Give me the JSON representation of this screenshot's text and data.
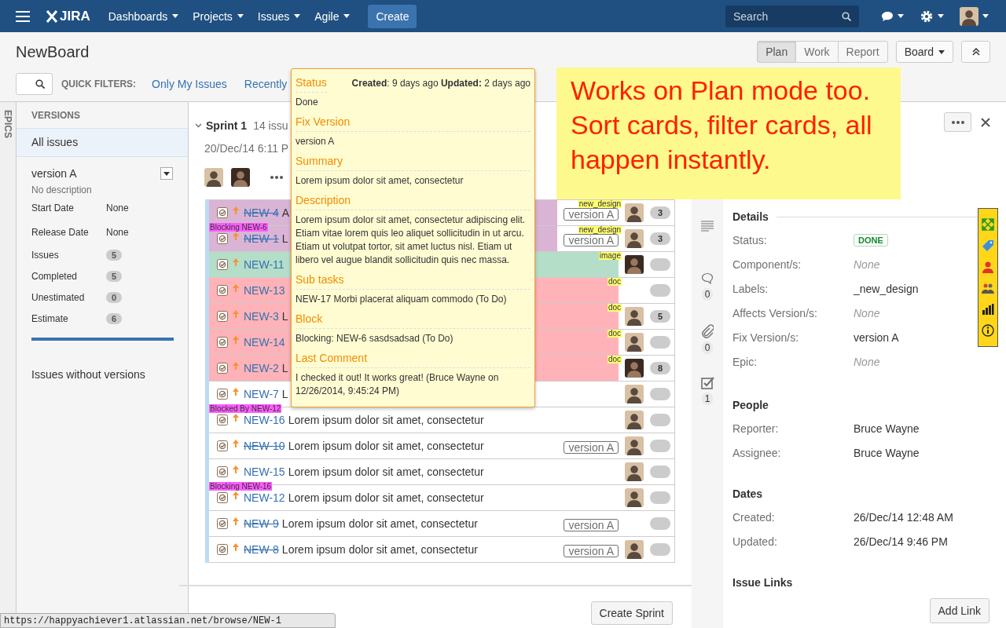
{
  "topbar": {
    "logo": "JIRA",
    "menu": [
      {
        "label": "Dashboards"
      },
      {
        "label": "Projects"
      },
      {
        "label": "Issues"
      },
      {
        "label": "Agile"
      }
    ],
    "create": "Create",
    "search": {
      "placeholder": "Search"
    }
  },
  "board": {
    "title": "NewBoard",
    "quick_filters_label": "QUICK FILTERS:",
    "quick_filters": [
      {
        "label": "Only My Issues"
      },
      {
        "label": "Recently"
      }
    ],
    "modes": [
      {
        "label": "Plan",
        "selected": true
      },
      {
        "label": "Work",
        "selected": false
      },
      {
        "label": "Report",
        "selected": false
      }
    ],
    "board_menu": "Board"
  },
  "epics_tab": "EPICS",
  "versions": {
    "heading": "VERSIONS",
    "items": [
      {
        "label": "All issues",
        "selected": true
      }
    ],
    "version": {
      "name": "version A",
      "description": "No description",
      "fields": [
        {
          "label": "Start Date",
          "value": "None"
        },
        {
          "label": "Release Date",
          "value": "None"
        }
      ],
      "stats": [
        {
          "label": "Issues",
          "count": "5"
        },
        {
          "label": "Completed",
          "count": "5"
        },
        {
          "label": "Unestimated",
          "count": "0"
        },
        {
          "label": "Estimate",
          "count": "6"
        }
      ],
      "progress": {
        "level": 1
      }
    },
    "without": "Issues without versions"
  },
  "sprint": {
    "name": "Sprint 1",
    "count": "14 issu",
    "date": "20/Dec/14 6:11 P",
    "participants": [
      {
        "kind": "light"
      },
      {
        "kind": "dark"
      }
    ],
    "rows": [
      {
        "key": "NEW-4",
        "done": true,
        "summary": "A",
        "color": "#dab4d5",
        "label": "new_design",
        "version": "version A",
        "assignee": {
          "kind": "light"
        },
        "estimate": "3"
      },
      {
        "key": "NEW-1",
        "done": true,
        "summary": "L",
        "color": "#dab4d5",
        "badge": "Blocking NEW-6",
        "label": "new_design",
        "version": "version A",
        "assignee": {
          "kind": "light"
        },
        "estimate": "3"
      },
      {
        "key": "NEW-11",
        "done": false,
        "color": "#b5dec9",
        "label": "image",
        "assignee": {
          "kind": "dark"
        }
      },
      {
        "key": "NEW-13",
        "done": false,
        "color": "#ffb3b8",
        "label": "doc"
      },
      {
        "key": "NEW-3",
        "done": false,
        "summary": "L",
        "color": "#ffb3b8",
        "label": "doc",
        "assignee": {
          "kind": "light"
        },
        "estimate": "5"
      },
      {
        "key": "NEW-14",
        "done": false,
        "color": "#ffb3b8",
        "label": "doc",
        "assignee": {
          "kind": "light"
        }
      },
      {
        "key": "NEW-2",
        "done": false,
        "summary": "L",
        "color": "#ffb3b8",
        "label": "doc",
        "assignee": {
          "kind": "dark"
        },
        "estimate": "8"
      },
      {
        "key": "NEW-7",
        "done": false,
        "summary": "L",
        "color": "#ffffff",
        "assignee": {
          "kind": "light"
        }
      },
      {
        "key": "NEW-16",
        "done": false,
        "summary": "Lorem ipsum dolor sit amet, consectetur",
        "color": "#ffffff",
        "badge": "Blocked By NEW-12",
        "assignee": {
          "kind": "light"
        }
      },
      {
        "key": "NEW-10",
        "done": true,
        "summary": "Lorem ipsum dolor sit amet, consectetur",
        "color": "#ffffff",
        "version": "version A",
        "assignee": {
          "kind": "light"
        }
      },
      {
        "key": "NEW-15",
        "done": false,
        "summary": "Lorem ipsum dolor sit amet, consectetur",
        "color": "#ffffff",
        "assignee": {
          "kind": "light"
        }
      },
      {
        "key": "NEW-12",
        "done": false,
        "summary": "Lorem ipsum dolor sit amet, consectetur",
        "color": "#ffffff",
        "badge": "Blocking NEW-16",
        "assignee": {
          "kind": "light"
        }
      },
      {
        "key": "NEW-9",
        "done": true,
        "summary": "Lorem ipsum dolor sit amet, consectetur",
        "color": "#ffffff",
        "version": "version A"
      },
      {
        "key": "NEW-8",
        "done": true,
        "summary": "Lorem ipsum dolor sit amet, consectetur",
        "color": "#ffffff",
        "version": "version A",
        "assignee": {
          "kind": "light"
        }
      }
    ]
  },
  "create_sprint": "Create Sprint",
  "detail": {
    "side": [
      {
        "kind": "description"
      },
      {
        "kind": "comments",
        "count": "0"
      },
      {
        "kind": "attachments",
        "count": "0"
      },
      {
        "kind": "subtasks",
        "count": "1"
      }
    ],
    "sections": [
      {
        "title": "Details",
        "fields": [
          {
            "label": "Status:",
            "value": "DONE",
            "kind": "status"
          },
          {
            "label": "Component/s:",
            "value": "None",
            "kind": "empty"
          },
          {
            "label": "Labels:",
            "value": "_new_design",
            "kind": "text"
          },
          {
            "label": "Affects Version/s:",
            "value": "None",
            "kind": "empty"
          },
          {
            "label": "Fix Version/s:",
            "value": "version A",
            "kind": "text"
          },
          {
            "label": "Epic:",
            "value": "None",
            "kind": "empty"
          }
        ]
      },
      {
        "title": "People",
        "fields": [
          {
            "label": "Reporter:",
            "value": "Bruce Wayne",
            "kind": "text"
          },
          {
            "label": "Assignee:",
            "value": "Bruce Wayne",
            "kind": "text"
          }
        ]
      },
      {
        "title": "Dates",
        "fields": [
          {
            "label": "Created:",
            "value": "26/Dec/14 12:48 AM",
            "kind": "text"
          },
          {
            "label": "Updated:",
            "value": "26/Dec/14 9:46 PM",
            "kind": "text"
          }
        ]
      },
      {
        "title": "Issue Links"
      }
    ],
    "add_link": "Add Link"
  },
  "hover_card": {
    "meta": "**Created**: 9 days ago **Updated:** 2 days ago",
    "sections": [
      {
        "title": "Status",
        "text": "Done"
      },
      {
        "title": "Fix Version",
        "text": "version A"
      },
      {
        "title": "Summary",
        "text": "Lorem ipsum dolor sit amet, consectetur"
      },
      {
        "title": "Description",
        "text": "Lorem ipsum dolor sit amet, consectetur adipiscing elit. Etiam vitae lorem quis leo aliquet sollicitudin in ut arcu. Etiam ut volutpat tortor, sit amet luctus nisl. Etiam ut libero vel augue blandit sollicitudin quis nec massa."
      },
      {
        "title": "Sub tasks",
        "text": "NEW-17 Morbi placerat aliquam commodo (To Do)"
      },
      {
        "title": "Block",
        "text": "Blocking: NEW-6 sasdsadsad (To Do)"
      },
      {
        "title": "Last Comment",
        "text": "I checked it out! It works great! (Bruce Wayne on 12/26/2014, 9:45:24 PM)"
      }
    ]
  },
  "note": "Works on Plan mode too. Sort cards, filter cards, all happen instantly.",
  "status_url": "https://happyachiever1.atlassian.net/browse/NEW-1"
}
